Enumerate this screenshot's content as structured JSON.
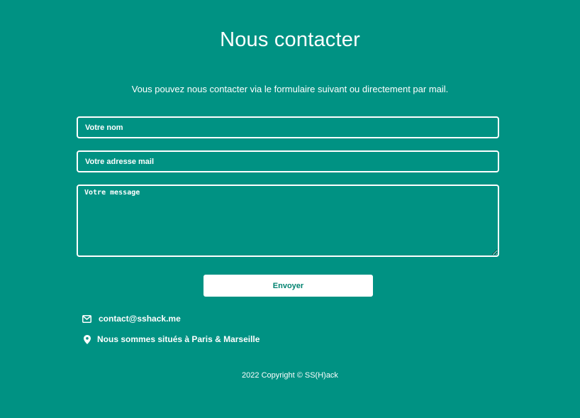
{
  "header": {
    "title": "Nous contacter",
    "subtitle": "Vous pouvez nous contacter via le formulaire suivant ou directement par mail."
  },
  "form": {
    "name_placeholder": "Votre nom",
    "email_placeholder": "Votre adresse mail",
    "message_placeholder": "Votre message",
    "submit_label": "Envoyer"
  },
  "contact": {
    "email": "contact@sshack.me",
    "email_icon": "envelope-icon",
    "location": "Nous sommes situés à Paris & Marseille",
    "location_icon": "map-marker-icon"
  },
  "footer": {
    "copyright": "2022 Copyright © SS(H)ack"
  },
  "colors": {
    "background": "#009283",
    "button_text": "#00826f",
    "foreground": "#ffffff"
  }
}
